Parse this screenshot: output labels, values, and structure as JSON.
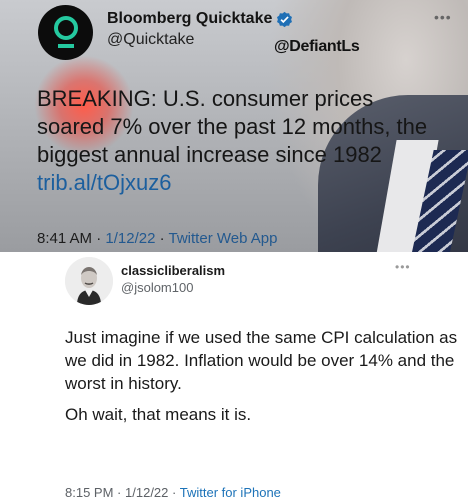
{
  "top_tweet": {
    "display_name": "Bloomberg Quicktake",
    "verified_icon": "verified-badge-icon",
    "handle": "@Quicktake",
    "watermark": "@DefiantLs",
    "menu_icon": "more-dots-icon",
    "text_line_1": "BREAKING: U.S. consumer prices",
    "text_line_2": "soared 7% over the past 12 months, the",
    "text_line_3": "biggest annual increase since 1982",
    "link": "trib.al/tOjxuz6",
    "time": "8:41 AM",
    "sep": "·",
    "date": "1/12/22",
    "source": "Twitter Web App",
    "colors": {
      "avatar_bg": "#0c0c0c",
      "logo_ring": "#25c9a0",
      "link": "#1c5f9e"
    }
  },
  "bottom_tweet": {
    "display_name": "classicliberalism",
    "handle": "@jsolom100",
    "menu_icon": "more-dots-icon",
    "paragraph_1": "Just imagine if we used the same CPI calculation as we did in 1982. Inflation would be over 14% and the worst in history.",
    "paragraph_2": "Oh wait, that means it is.",
    "time": "8:15 PM",
    "sep": "·",
    "date": "1/12/22",
    "source": "Twitter for iPhone",
    "colors": {
      "link": "#1d73b8",
      "meta": "#5d6166"
    }
  }
}
